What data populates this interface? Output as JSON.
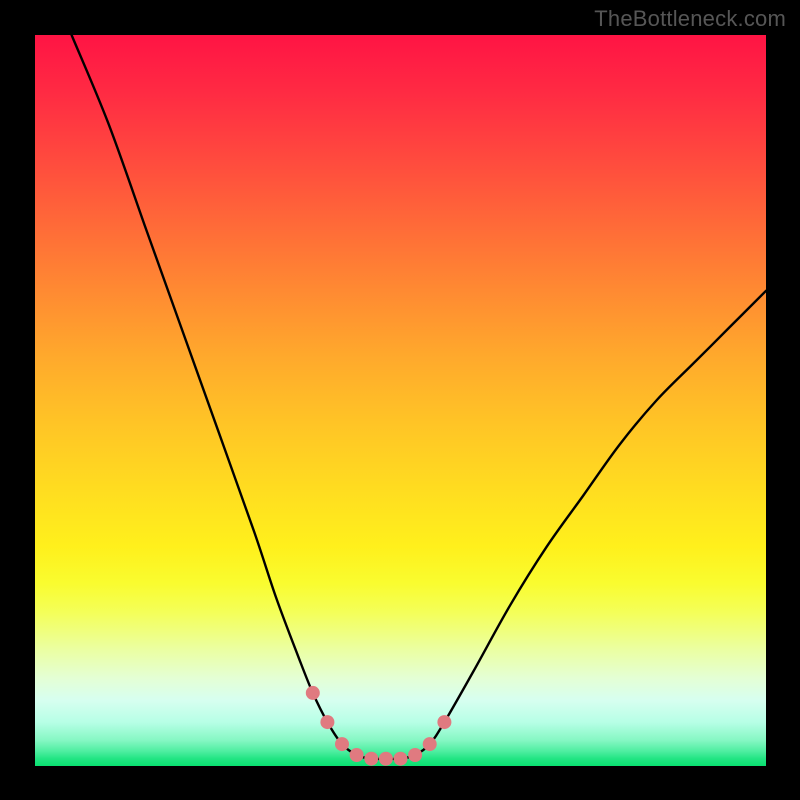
{
  "watermark": {
    "text": "TheBottleneck.com"
  },
  "chart_data": {
    "type": "line",
    "title": "",
    "xlabel": "",
    "ylabel": "",
    "xlim": [
      0,
      100
    ],
    "ylim": [
      0,
      100
    ],
    "grid": false,
    "series": [
      {
        "name": "bottleneck-curve",
        "color": "#000000",
        "x": [
          5,
          10,
          15,
          20,
          25,
          30,
          33,
          36,
          38,
          40,
          42,
          44,
          46,
          48,
          50,
          52,
          54,
          56,
          60,
          65,
          70,
          75,
          80,
          85,
          90,
          95,
          100
        ],
        "y": [
          100,
          88,
          74,
          60,
          46,
          32,
          23,
          15,
          10,
          6,
          3,
          1.5,
          1,
          1,
          1,
          1.5,
          3,
          6,
          13,
          22,
          30,
          37,
          44,
          50,
          55,
          60,
          65
        ]
      }
    ],
    "markers": {
      "name": "optimal-range-dots",
      "color": "#e07a80",
      "x": [
        38,
        40,
        42,
        44,
        46,
        48,
        50,
        52,
        54,
        56
      ],
      "y": [
        10,
        6,
        3,
        1.5,
        1,
        1,
        1,
        1.5,
        3,
        6
      ]
    },
    "gradient_stops": [
      {
        "pos": 0,
        "color": "#ff1444"
      },
      {
        "pos": 50,
        "color": "#ffc426"
      },
      {
        "pos": 75,
        "color": "#f9fc2f"
      },
      {
        "pos": 100,
        "color": "#09e070"
      }
    ]
  }
}
